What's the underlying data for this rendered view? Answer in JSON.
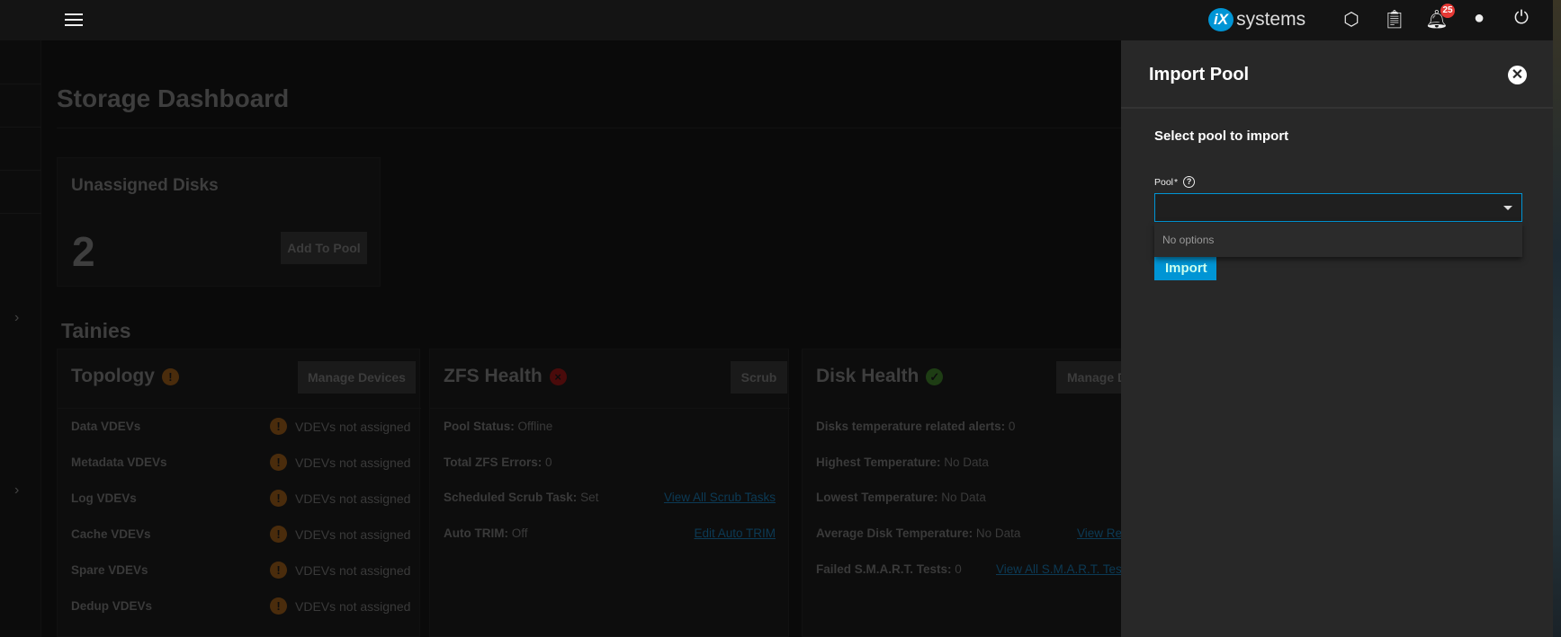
{
  "topbar": {
    "brand": "iXsystems",
    "brand_prefix": "iX",
    "brand_suffix": "systems",
    "notification_count": "25"
  },
  "page": {
    "title": "Storage Dashboard"
  },
  "unassigned": {
    "title": "Unassigned Disks",
    "count": "2",
    "button": "Add To Pool"
  },
  "pool": {
    "name": "Tainies"
  },
  "topology": {
    "title": "Topology",
    "button": "Manage Devices",
    "rows": [
      {
        "label": "Data VDEVs",
        "value": "VDEVs not assigned"
      },
      {
        "label": "Metadata VDEVs",
        "value": "VDEVs not assigned"
      },
      {
        "label": "Log VDEVs",
        "value": "VDEVs not assigned"
      },
      {
        "label": "Cache VDEVs",
        "value": "VDEVs not assigned"
      },
      {
        "label": "Spare VDEVs",
        "value": "VDEVs not assigned"
      },
      {
        "label": "Dedup VDEVs",
        "value": "VDEVs not assigned"
      }
    ]
  },
  "zfs": {
    "title": "ZFS Health",
    "button": "Scrub",
    "rows": [
      {
        "label": "Pool Status:",
        "value": "Offline",
        "link": ""
      },
      {
        "label": "Total ZFS Errors:",
        "value": "0",
        "link": ""
      },
      {
        "label": "Scheduled Scrub Task:",
        "value": "Set",
        "link": "View All Scrub Tasks"
      },
      {
        "label": "Auto TRIM:",
        "value": "Off",
        "link": "Edit Auto TRIM"
      }
    ]
  },
  "disk": {
    "title": "Disk Health",
    "button": "Manage Disks",
    "rows": [
      {
        "label": "Disks temperature related alerts:",
        "value": "0",
        "link": ""
      },
      {
        "label": "Highest Temperature:",
        "value": "No Data",
        "link": ""
      },
      {
        "label": "Lowest Temperature:",
        "value": "No Data",
        "link": ""
      },
      {
        "label": "Average Disk Temperature:",
        "value": "No Data",
        "link": "View Reports"
      },
      {
        "label": "Failed S.M.A.R.T. Tests:",
        "value": "0",
        "link": "View All S.M.A.R.T. Tests"
      }
    ]
  },
  "drawer": {
    "title": "Import Pool",
    "subtitle": "Select pool to import",
    "field_label": "Pool",
    "required": "*",
    "field_value": "",
    "no_options": "No options",
    "import_button": "Import"
  },
  "colors": {
    "accent": "#0095d5",
    "badge": "#e53935",
    "warn": "#e67e22",
    "error": "#c62828",
    "ok": "#4caf50"
  }
}
